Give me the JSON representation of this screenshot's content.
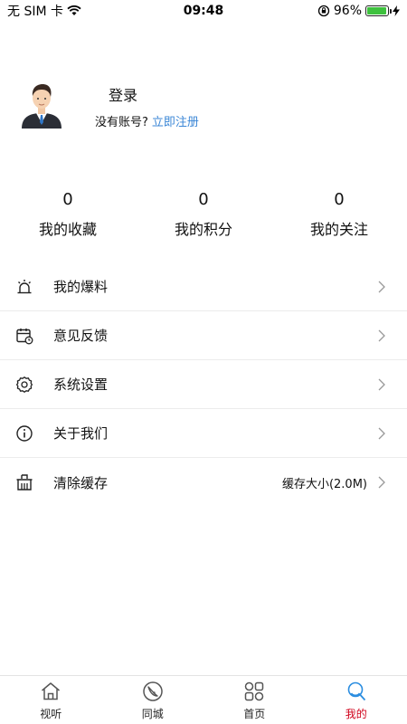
{
  "status_bar": {
    "carrier": "无 SIM 卡",
    "time": "09:48",
    "battery": "96%",
    "battery_level": 0.96
  },
  "profile": {
    "login_label": "登录",
    "no_account_text": "没有账号?",
    "register_link": "立即注册"
  },
  "stats": [
    {
      "value": "0",
      "label": "我的收藏"
    },
    {
      "value": "0",
      "label": "我的积分"
    },
    {
      "value": "0",
      "label": "我的关注"
    }
  ],
  "menu": [
    {
      "label": "我的爆料",
      "icon": "alarm-icon",
      "value": ""
    },
    {
      "label": "意见反馈",
      "icon": "calendar-clock-icon",
      "value": ""
    },
    {
      "label": "系统设置",
      "icon": "gear-icon",
      "value": ""
    },
    {
      "label": "关于我们",
      "icon": "info-icon",
      "value": ""
    },
    {
      "label": "清除缓存",
      "icon": "basket-icon",
      "value": "缓存大小(2.0M)"
    }
  ],
  "tabbar": {
    "active_color": "#d0021b",
    "tabs": [
      {
        "label": "视听",
        "icon": "home-icon"
      },
      {
        "label": "同城",
        "icon": "compass-icon"
      },
      {
        "label": "首页",
        "icon": "grid-icon"
      },
      {
        "label": "我的",
        "icon": "user-search-icon",
        "active": true
      }
    ]
  }
}
